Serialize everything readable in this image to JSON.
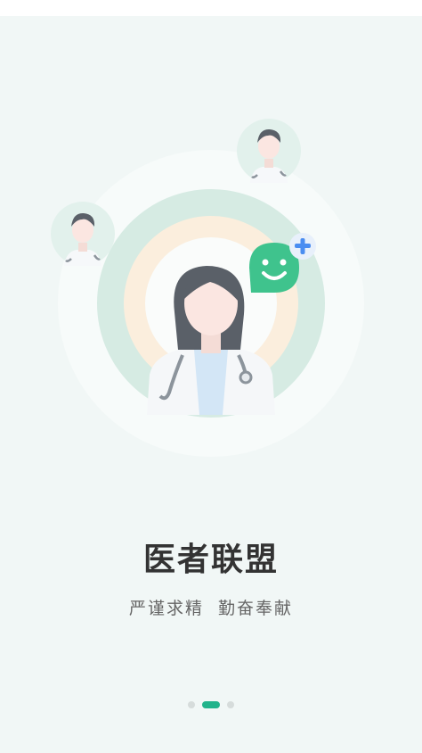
{
  "onboarding": {
    "title": "医者联盟",
    "subtitle": "严谨求精  勤奋奉献",
    "page_indicator": {
      "total": 3,
      "current": 2
    }
  },
  "colors": {
    "background": "#f1f7f6",
    "accent_green": "#21b38b",
    "ring_green": "#d6ebe3",
    "ring_peach": "#fbeedd",
    "bubble_green": "#3fc38d",
    "plus_blue": "#4a8df1"
  },
  "illustration": {
    "main_figure": "female-doctor-avatar",
    "side_figures": [
      "male-doctor-avatar-left",
      "male-doctor-avatar-top-right"
    ],
    "badge_icon": "smile-chat-bubble-icon",
    "add_icon": "plus-icon"
  }
}
